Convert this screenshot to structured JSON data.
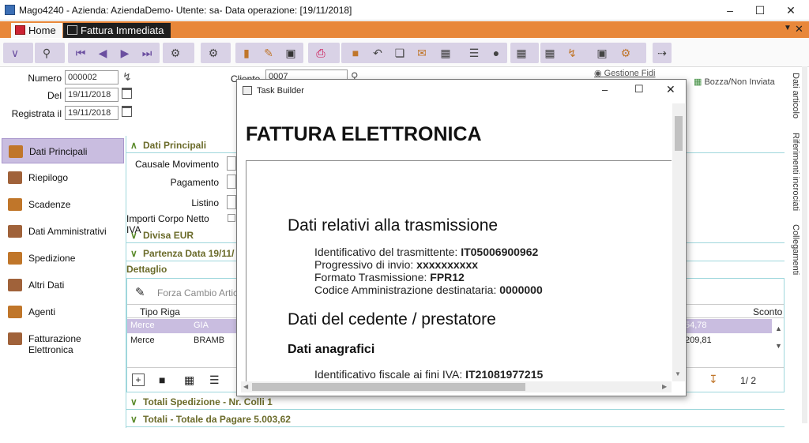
{
  "window": {
    "title": "Mago4240 - Azienda: AziendaDemo- Utente: sa- Data operazione: [19/11/2018]"
  },
  "tabs": [
    {
      "label": "Home"
    },
    {
      "label": "Fattura Immediata"
    }
  ],
  "header": {
    "numero_label": "Numero",
    "numero_value": "000002",
    "del_label": "Del",
    "del_value": "19/11/2018",
    "registrata_label": "Registrata il",
    "registrata_value": "19/11/2018",
    "cliente_label": "Cliente",
    "cliente_value": "0007",
    "gestione_fidi": "Gestione Fidi",
    "status": "Bozza/Non Inviata"
  },
  "nav": [
    {
      "label": "Dati Principali"
    },
    {
      "label": "Riepilogo"
    },
    {
      "label": "Scadenze"
    },
    {
      "label": "Dati Amministrativi"
    },
    {
      "label": "Spedizione"
    },
    {
      "label": "Altri Dati"
    },
    {
      "label": "Agenti"
    },
    {
      "label": "Fatturazione Elettronica"
    }
  ],
  "dati_principali": {
    "title": "Dati Principali",
    "causale_label": "Causale Movimento",
    "pagamento_label": "Pagamento",
    "listino_label": "Listino",
    "importi_label": "Importi Corpo Netto IVA",
    "divisa": "Divisa EUR",
    "partenza": "Partenza Data 19/11/"
  },
  "dettaglio": {
    "title": "Dettaglio",
    "forza_placeholder": "Forza Cambio Artico",
    "col_tipo": "Tipo Riga",
    "col_sconto": "Sconto",
    "rows": [
      {
        "tipo": "Merce",
        "code": "GIA",
        "value": "54,78"
      },
      {
        "tipo": "Merce",
        "code": "BRAMB",
        "value": "209,81"
      }
    ],
    "page": "1/ 2"
  },
  "totali_spedizione": "Totali Spedizione - Nr. Colli 1",
  "totali": "Totali - Totale da Pagare 5.003,62",
  "right_tabs": [
    "Dati articolo",
    "Riferimenti incrociati",
    "Collegamenti"
  ],
  "dialog": {
    "title": "Task Builder",
    "doc_title": "FATTURA ELETTRONICA",
    "h_trasmissione": "Dati relativi alla trasmissione",
    "lines": [
      {
        "label": "Identificativo del trasmittente: ",
        "value": "IT05006900962"
      },
      {
        "label": "Progressivo di invio: ",
        "value": "xxxxxxxxxx"
      },
      {
        "label": "Formato Trasmissione: ",
        "value": "FPR12"
      },
      {
        "label": "Codice Amministrazione destinataria: ",
        "value": "0000000"
      }
    ],
    "h_cedente": "Dati del cedente / prestatore",
    "h_anagrafici": "Dati anagrafici",
    "iva_label": "Identificativo fiscale ai fini IVA: ",
    "iva_value": "IT21081977215"
  }
}
